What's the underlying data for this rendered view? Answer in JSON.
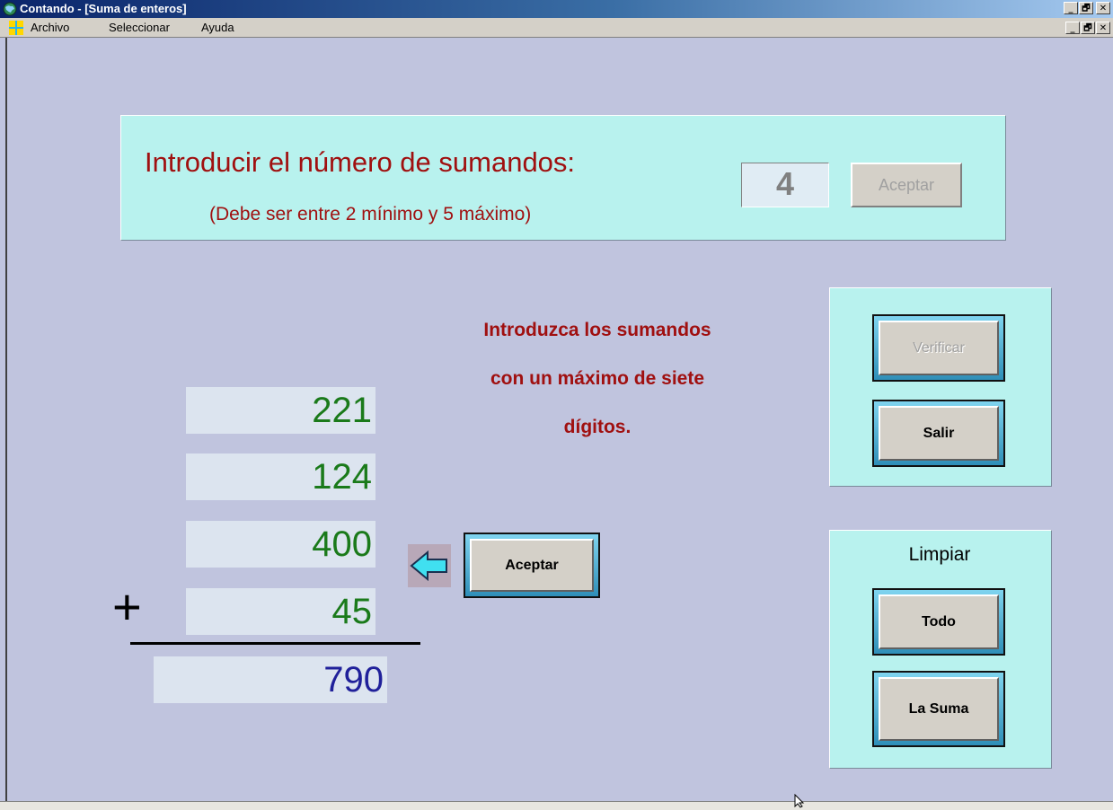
{
  "window": {
    "title": "Contando - [Suma de enteros]",
    "controls": {
      "minimize": "_",
      "restore": "🗗",
      "close": "✕"
    }
  },
  "menu": {
    "items": [
      "Archivo",
      "Seleccionar",
      "Ayuda"
    ]
  },
  "count_panel": {
    "heading": "Introducir el número de sumandos:",
    "subheading": "(Debe ser entre 2 mínimo y 5 máximo)",
    "count_value": "4",
    "accept_label": "Aceptar"
  },
  "instructions": [
    "Introduzca los sumandos",
    "con un máximo de siete",
    "dígitos."
  ],
  "addends": [
    "221",
    "124",
    "400",
    "45"
  ],
  "operator": "+",
  "result": "790",
  "accept_addends_label": "Aceptar",
  "actions": {
    "verify_label": "Verificar",
    "exit_label": "Salir"
  },
  "clear_panel": {
    "title": "Limpiar",
    "all_label": "Todo",
    "sum_label": "La Suma"
  },
  "colors": {
    "background": "#c0c4de",
    "panel": "#b8f2ee",
    "heading": "#a01010",
    "addend_text": "#1a7a1a",
    "result_text": "#20209a",
    "arrow": "#40e0f0"
  }
}
